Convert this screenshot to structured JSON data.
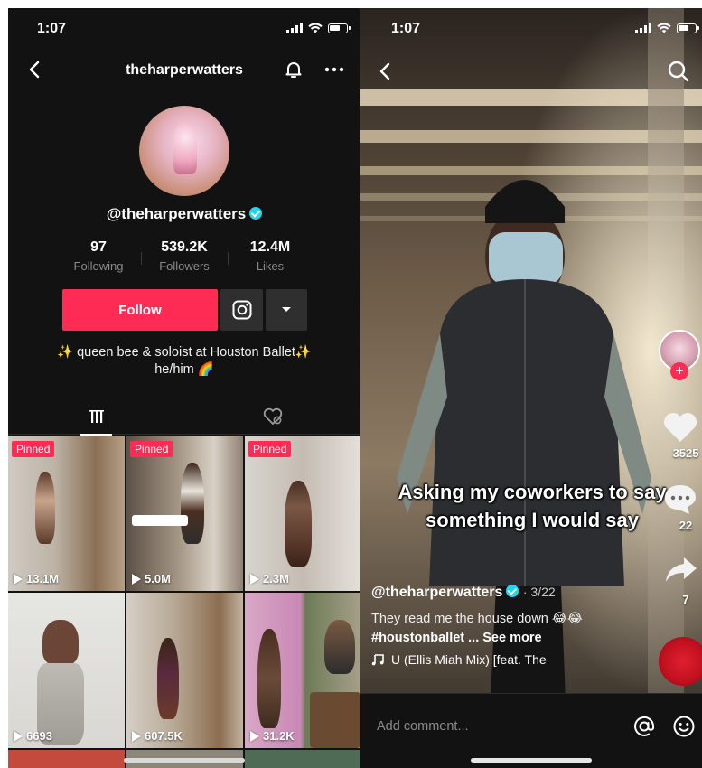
{
  "left": {
    "status_time": "1:07",
    "header_title": "theharperwatters",
    "handle": "@theharperwatters",
    "stats": [
      {
        "value": "97",
        "label": "Following"
      },
      {
        "value": "539.2K",
        "label": "Followers"
      },
      {
        "value": "12.4M",
        "label": "Likes"
      }
    ],
    "follow_label": "Follow",
    "bio_line1": "✨ queen bee & soloist at Houston Ballet✨",
    "bio_line2": "he/him 🌈",
    "grid": [
      {
        "pinned": "Pinned",
        "views": "13.1M"
      },
      {
        "pinned": "Pinned",
        "views": "5.0M"
      },
      {
        "pinned": "Pinned",
        "views": "2.3M"
      },
      {
        "pinned": "",
        "views": "6693"
      },
      {
        "pinned": "",
        "views": "607.5K"
      },
      {
        "pinned": "",
        "views": "31.2K"
      }
    ],
    "colors": {
      "accent": "#fe2c55",
      "bg": "#121212",
      "verified": "#20d5ec"
    }
  },
  "right": {
    "status_time": "1:07",
    "overlay_line1": "Asking my coworkers to say",
    "overlay_line2": "something I would say",
    "likes": "3525",
    "comments": "22",
    "shares": "7",
    "username": "@theharperwatters",
    "date": "· 3/22",
    "description": "They read me the house down 😂😂",
    "hashtags": "#houstonballet ...",
    "see_more": "See more",
    "music": "U (Ellis Miah Mix) [feat. The",
    "comment_placeholder": "Add comment..."
  }
}
